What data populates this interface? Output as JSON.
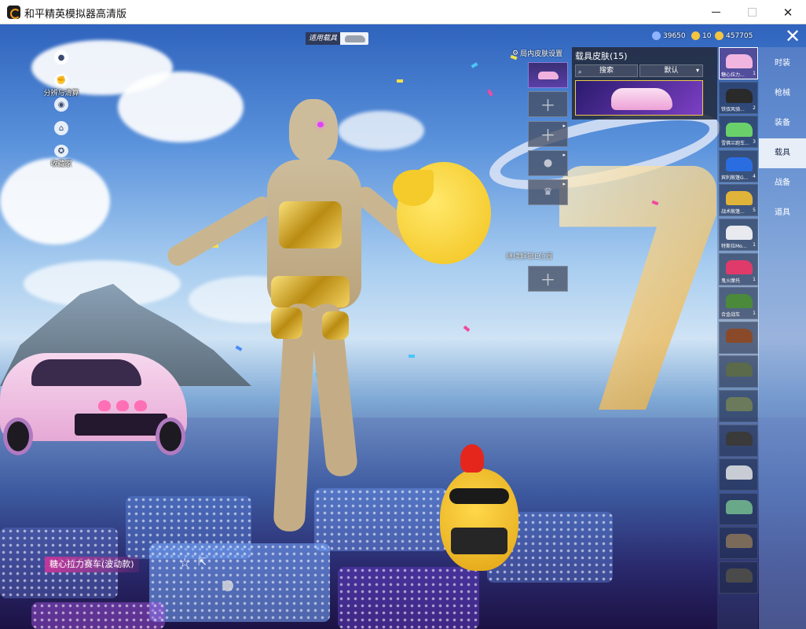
{
  "window": {
    "title": "和平精英模拟器高清版",
    "close_symbol": "✕",
    "min_symbol": "",
    "max_symbol": ""
  },
  "left_hud": {
    "items": [
      {
        "label": "",
        "icon": "person-icon"
      },
      {
        "label": "分辨与清算",
        "icon": "fist-icon"
      },
      {
        "label": "",
        "icon": "eye-icon"
      },
      {
        "label": "",
        "icon": "house-icon"
      },
      {
        "label": "收藏家",
        "icon": "badge-icon"
      }
    ]
  },
  "apply_tag": {
    "label": "适用载具"
  },
  "currency": [
    {
      "value": "39650",
      "color": "#8fb4ff"
    },
    {
      "value": "10",
      "color": "#f5c542"
    },
    {
      "value": "457705",
      "color": "#f5c542"
    }
  ],
  "close_button": {
    "symbol": "✕"
  },
  "skin_settings": {
    "label": "局内皮肤设置",
    "slot_symbol": "＋",
    "unlock_note": "继续解锁E位置"
  },
  "skin_panel": {
    "title": "载具皮肤(15)",
    "search_label": "搜索",
    "sort_label": "默认",
    "selected_name": "糖心拉力赛车(波动款)"
  },
  "vehicles": [
    {
      "name": "糖心拉力...",
      "count": "1",
      "color": "#f2b5e0"
    },
    {
      "name": "铁驭风骑...",
      "count": "2",
      "color": "#2a2a2a"
    },
    {
      "name": "雪佛兰跑车...",
      "count": "3",
      "color": "#6ad16a"
    },
    {
      "name": "宾利敞篷G...",
      "count": "4",
      "color": "#2a6de0"
    },
    {
      "name": "战术敞篷...",
      "count": "5",
      "color": "#e0b43a"
    },
    {
      "name": "特斯拉Mo...",
      "count": "1",
      "color": "#e8eaf0"
    },
    {
      "name": "鬼火摩托",
      "count": "1",
      "color": "#e03a6a"
    },
    {
      "name": "合金战车",
      "count": "1",
      "color": "#4a8a3a"
    },
    {
      "name": "",
      "count": "",
      "color": "#8a4a2a"
    },
    {
      "name": "",
      "count": "",
      "color": "#5a6a4a"
    },
    {
      "name": "",
      "count": "",
      "color": "#6a7a5a"
    },
    {
      "name": "",
      "count": "",
      "color": "#3a3a3a"
    },
    {
      "name": "",
      "count": "",
      "color": "#c8ccd4"
    },
    {
      "name": "",
      "count": "",
      "color": "#6aa88a"
    },
    {
      "name": "",
      "count": "",
      "color": "#7a6a5a"
    },
    {
      "name": "",
      "count": "",
      "color": "#4a4a4a"
    }
  ],
  "categories": [
    {
      "label": "时装",
      "active": false
    },
    {
      "label": "枪械",
      "active": false
    },
    {
      "label": "装备",
      "active": false
    },
    {
      "label": "载具",
      "active": true
    },
    {
      "label": "战备",
      "active": false
    },
    {
      "label": "道具",
      "active": false
    }
  ],
  "bottom": {
    "vehicle_name": "糖心拉力赛车(波动款)"
  }
}
